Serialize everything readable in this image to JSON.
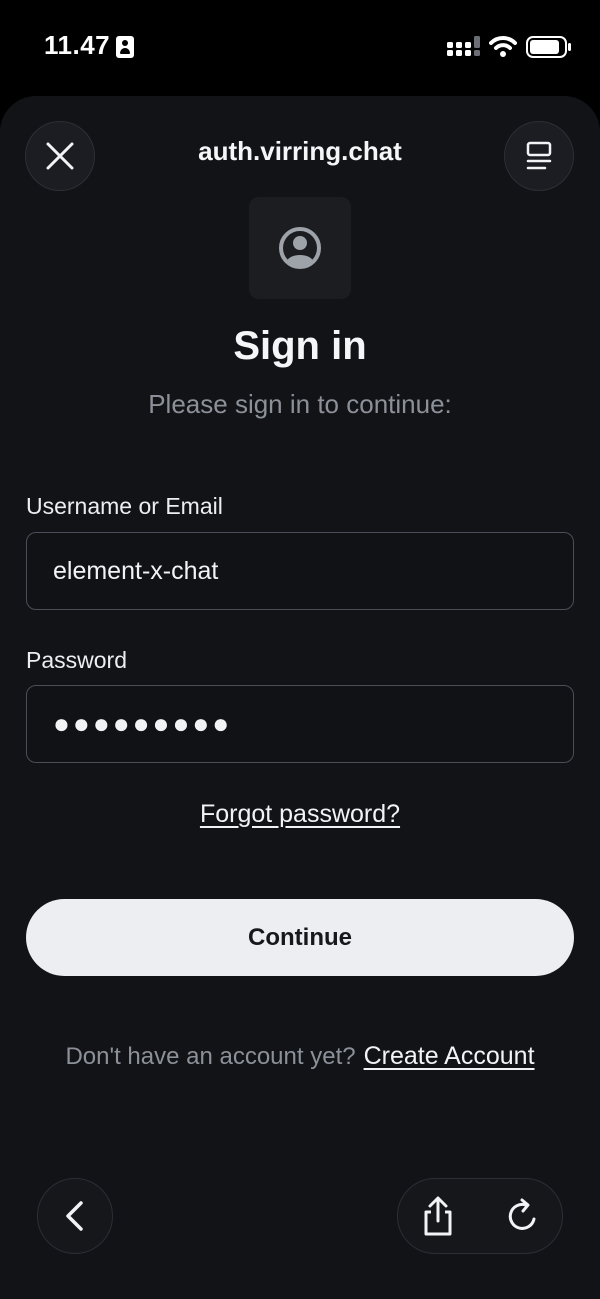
{
  "status_bar": {
    "time": "11.47",
    "icons": [
      "person-badge-icon",
      "cellular-signal-icon",
      "wifi-icon",
      "battery-icon"
    ]
  },
  "header": {
    "url": "auth.virring.chat",
    "close_icon": "close-icon",
    "tabs_icon": "tabs-icon"
  },
  "content": {
    "avatar_icon": "user-avatar-icon",
    "title": "Sign in",
    "subtitle": "Please sign in to continue:",
    "username": {
      "label": "Username or Email",
      "value": "element-x-chat"
    },
    "password": {
      "label": "Password",
      "value": "●●●●●●●●●"
    },
    "forgot_link": "Forgot password?",
    "continue_label": "Continue",
    "signup_prompt": "Don't have an account yet?",
    "create_account_link": "Create Account"
  },
  "footer": {
    "icons": [
      "chevron-left-icon",
      "share-icon",
      "reload-icon"
    ]
  },
  "colors": {
    "background": "#111317",
    "button": "#eceef2",
    "muted_text": "#8c9098"
  }
}
